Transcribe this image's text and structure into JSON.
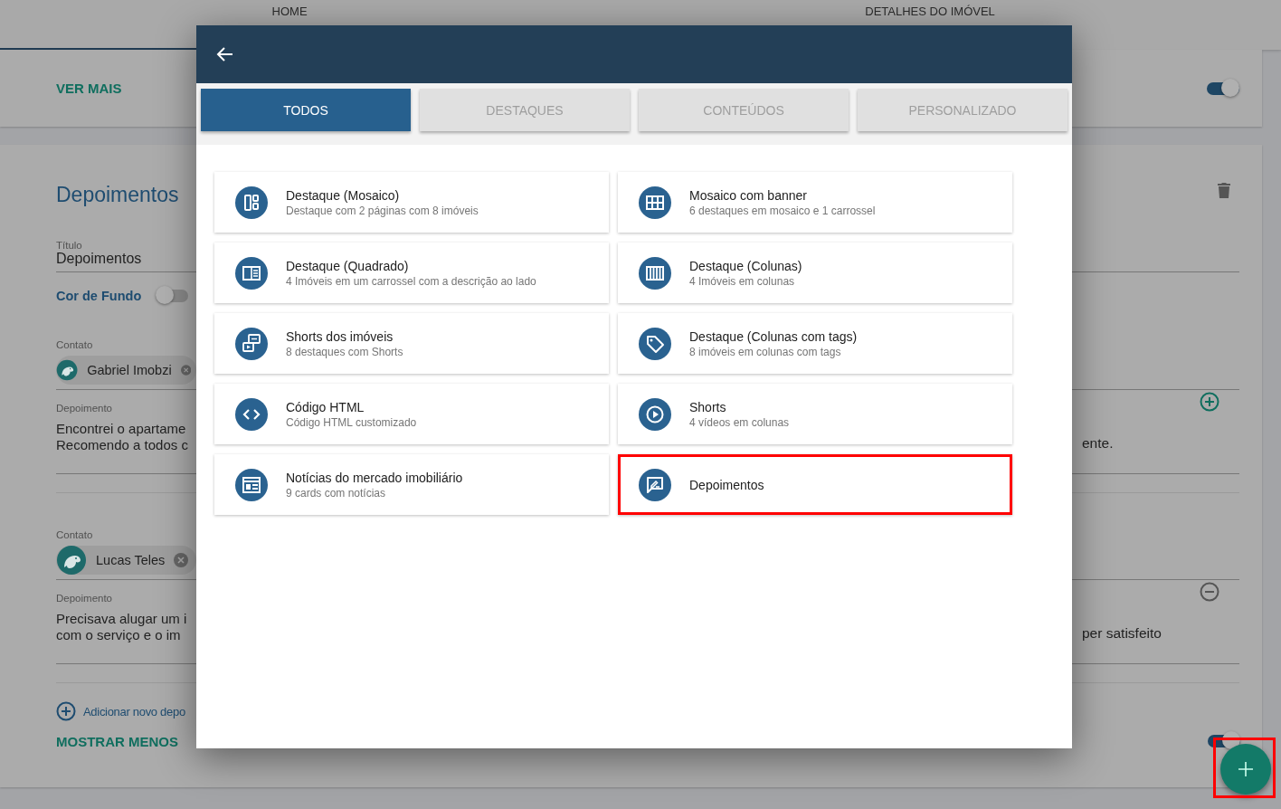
{
  "top_tabs": [
    {
      "label": "HOME",
      "selected": true
    },
    {
      "label": "DETALHES DO IMÓVEL",
      "selected": false
    }
  ],
  "first_section": {
    "link": "VER MAIS",
    "toggle_on": true
  },
  "section": {
    "title": "Depoimentos",
    "title_field": {
      "label": "Título",
      "value": "Depoimentos"
    },
    "background_color": {
      "label": "Cor de Fundo",
      "on": false
    },
    "testimonials": [
      {
        "contact_label": "Contato",
        "contact": "Gabriel Imobzi",
        "text_label": "Depoimento",
        "text_left": [
          "Encontrei o apartame",
          "Recomendo a todos c"
        ],
        "text_right": "ente.",
        "kind": "add"
      },
      {
        "contact_label": "Contato",
        "contact": "Lucas Teles",
        "text_label": "Depoimento",
        "text_left": [
          "Precisava alugar um i",
          "com o serviço e o im"
        ],
        "text_right": "per satisfeito",
        "kind": "remove"
      }
    ],
    "add_link": "Adicionar novo depo",
    "show_less": "MOSTRAR MENOS",
    "bottom_toggle_on": true
  },
  "dialog": {
    "tabs": [
      {
        "label": "TODOS",
        "selected": true
      },
      {
        "label": "DESTAQUES",
        "selected": false
      },
      {
        "label": "CONTEÚDOS",
        "selected": false
      },
      {
        "label": "PERSONALIZADO",
        "selected": false
      }
    ],
    "options": [
      {
        "kind": "mosaic",
        "title": "Destaque (Mosaico)",
        "subtitle": "Destaque com 2 páginas com 8 imóveis",
        "highlighted": false
      },
      {
        "kind": "grid",
        "title": "Mosaico com banner",
        "subtitle": "6 destaques em mosaico e 1 carrossel",
        "highlighted": false
      },
      {
        "kind": "square",
        "title": "Destaque (Quadrado)",
        "subtitle": "4 Imóveis em um carrossel com a descrição ao lado",
        "highlighted": false
      },
      {
        "kind": "columns",
        "title": "Destaque (Colunas)",
        "subtitle": "4 Imóveis em colunas",
        "highlighted": false
      },
      {
        "kind": "shorts",
        "title": "Shorts dos imóveis",
        "subtitle": "8 destaques com Shorts",
        "highlighted": false
      },
      {
        "kind": "tag",
        "title": "Destaque (Colunas com tags)",
        "subtitle": "8 imóveis em colunas com tags",
        "highlighted": false
      },
      {
        "kind": "code",
        "title": "Código HTML",
        "subtitle": "Código HTML customizado",
        "highlighted": false
      },
      {
        "kind": "play",
        "title": "Shorts",
        "subtitle": "4 vídeos em colunas",
        "highlighted": false
      },
      {
        "kind": "news",
        "title": "Notícias do mercado imobiliário",
        "subtitle": "9 cards com notícias",
        "highlighted": false
      },
      {
        "kind": "testimonial",
        "title": "Depoimentos",
        "highlighted": true
      }
    ]
  },
  "fab": {
    "highlighted": true
  }
}
